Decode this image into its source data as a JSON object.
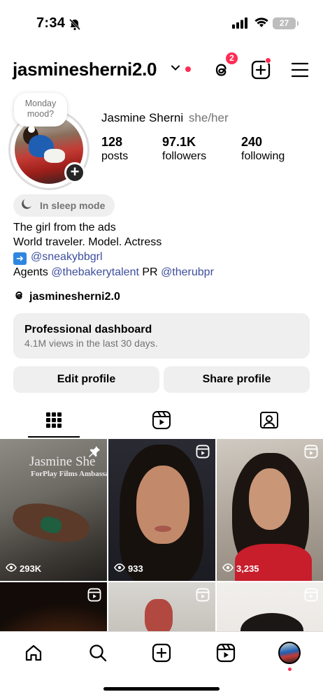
{
  "status_bar": {
    "time": "7:34",
    "battery": "27"
  },
  "header": {
    "username": "jasminesherni2.0",
    "threads_badge_count": "2"
  },
  "profile": {
    "note": [
      "Monday",
      "mood?"
    ],
    "full_name": "Jasmine Sherni",
    "pronouns": "she/her",
    "stats": {
      "posts": {
        "value": "128",
        "label": "posts"
      },
      "followers": {
        "value": "97.1K",
        "label": "followers"
      },
      "following": {
        "value": "240",
        "label": "following"
      }
    },
    "sleep_mode": "In sleep mode",
    "bio": {
      "line1": "The girl from the ads",
      "line2": "World traveler. Model. Actress",
      "line3_link": "@sneakybbgrl",
      "line4_prefix": "Agents",
      "line4_link1": "@thebakerytalent",
      "line4_mid": "PR",
      "line4_link2": "@therubpr"
    },
    "threads_handle": "jasminesherni2.0"
  },
  "dashboard": {
    "title": "Professional dashboard",
    "subtitle": "4.1M views in the last 30 days."
  },
  "buttons": {
    "edit": "Edit profile",
    "share": "Share profile"
  },
  "grid": {
    "posts": [
      {
        "views": "293K",
        "overlay_line1": "Jasmine She",
        "overlay_line2": "ForPlay Films Ambassa",
        "corner_icon": "pin-icon"
      },
      {
        "views": "933",
        "corner_icon": "reel-icon"
      },
      {
        "views": "3,235",
        "corner_icon": "reel-icon"
      },
      {
        "corner_icon": "reel-icon"
      },
      {
        "corner_icon": "reel-icon"
      },
      {
        "corner_icon": "reel-icon"
      }
    ]
  },
  "colors": {
    "accent_red": "#ff2d55",
    "link_blue": "#3d4e9d",
    "button_gray": "#efefef",
    "muted_text": "#737373"
  }
}
